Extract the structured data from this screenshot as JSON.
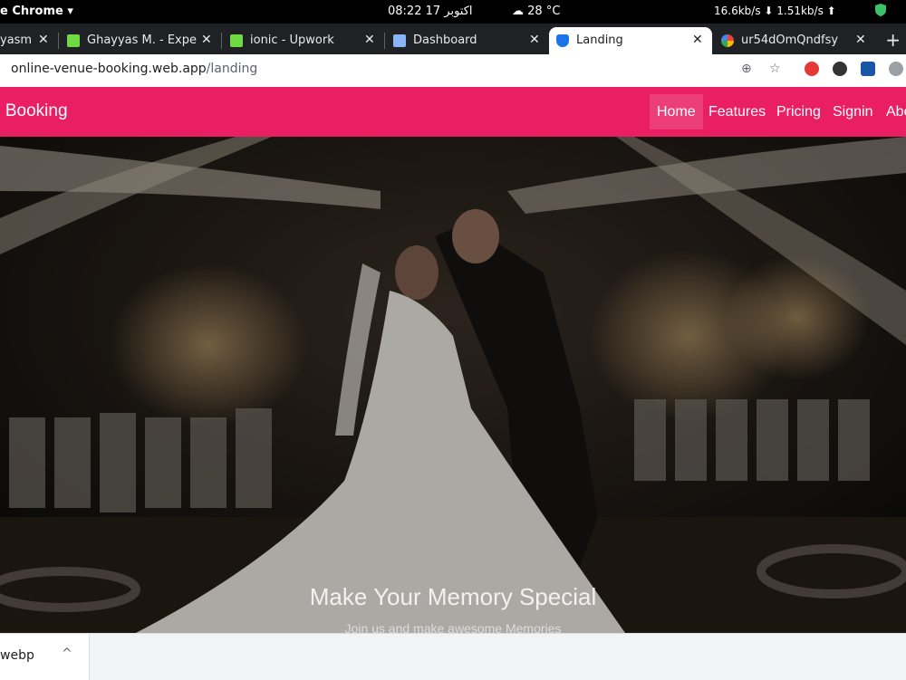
{
  "os": {
    "app_menu": "e Chrome ▾",
    "clock": "08:22  17 اکتوبر",
    "weather": "28 °C",
    "net": "16.6kb/s ⬇  1.51kb/s ⬆"
  },
  "tabs": [
    {
      "label": "yasm",
      "fav_color": "#9aa0a6"
    },
    {
      "label": "Ghayyas M. - Expe",
      "fav_color": "#6fda44"
    },
    {
      "label": "ionic - Upwork",
      "fav_color": "#6fda44"
    },
    {
      "label": "Dashboard",
      "fav_color": "#8ab4f8"
    },
    {
      "label": "Landing",
      "fav_color": "#1a73e8"
    },
    {
      "label": "ur54dOmQndfsy",
      "fav_color": "#fbbc04"
    }
  ],
  "omnibox": {
    "host": "online-venue-booking.web.app",
    "path": "/landing"
  },
  "page": {
    "brand": "e Booking",
    "nav": [
      "Home",
      "Features",
      "Pricing",
      "Signin",
      "Abo"
    ],
    "hero_title": "Make Your Memory Special",
    "hero_subtitle": "Join us and make awesome Memories"
  },
  "download": {
    "filename": "webp",
    "caret": "^"
  },
  "colors": {
    "navbar": "#e91e63",
    "tabbar": "#202124"
  }
}
